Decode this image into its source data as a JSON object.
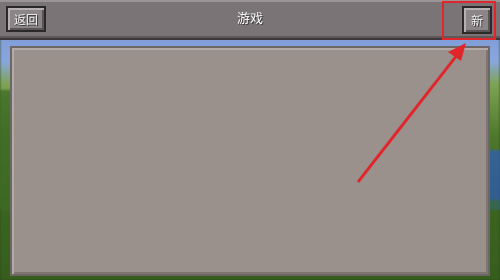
{
  "header": {
    "back_label": "返回",
    "title": "游戏",
    "new_label": "新"
  },
  "annotation": {
    "color": "#e0262b"
  },
  "world_list": {
    "items": []
  }
}
